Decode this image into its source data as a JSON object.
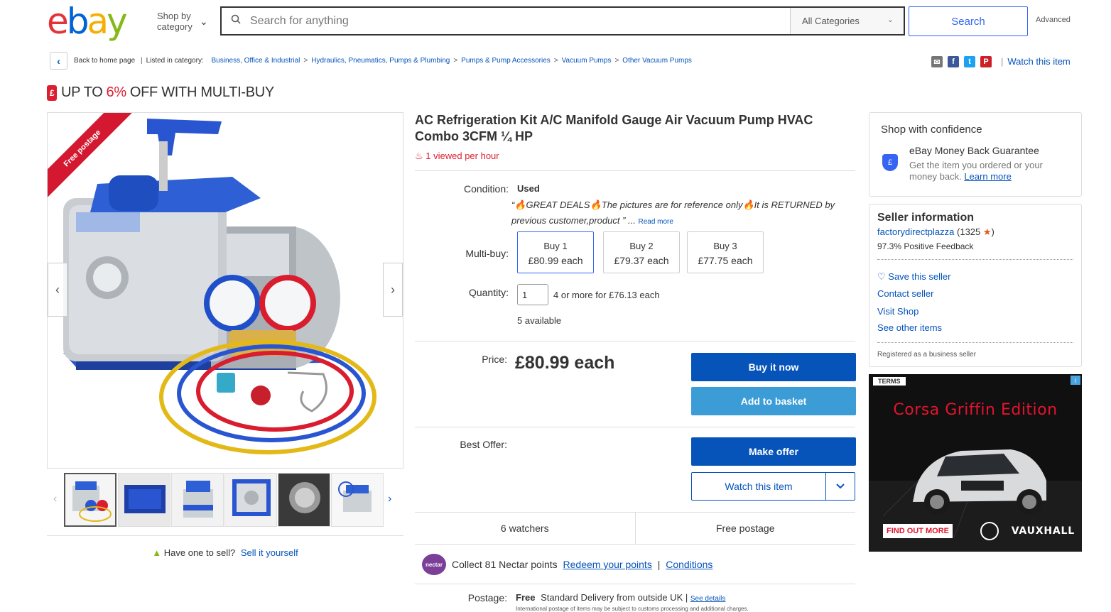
{
  "header": {
    "logo_letters": [
      "e",
      "b",
      "a",
      "y"
    ],
    "logo_colors": [
      "#e53238",
      "#0064d2",
      "#f5af02",
      "#86b817"
    ],
    "shop_by_line1": "Shop by",
    "shop_by_line2": "category",
    "search_placeholder": "Search for anything",
    "category_select": "All Categories",
    "search_button": "Search",
    "advanced_link": "Advanced"
  },
  "breadcrumb": {
    "back_label": "Back to home page",
    "listed_in": "Listed in category:",
    "items": [
      "Business, Office & Industrial",
      "Hydraulics, Pneumatics, Pumps & Plumbing",
      "Pumps & Pump Accessories",
      "Vacuum Pumps",
      "Other Vacuum Pumps"
    ],
    "watch_item": "Watch this item",
    "share_icons": [
      "email-icon",
      "facebook-icon",
      "twitter-icon",
      "pinterest-icon"
    ]
  },
  "promo": {
    "prefix": "UP TO",
    "percent": "6%",
    "suffix": "OFF WITH MULTI-BUY"
  },
  "gallery": {
    "ribbon": "Free postage",
    "thumbnail_count": 6
  },
  "sell": {
    "question": "Have one to sell?",
    "link": "Sell it yourself"
  },
  "item": {
    "title": "AC Refrigeration Kit A/C Manifold Gauge Air Vacuum Pump HVAC Combo 3CFM ¼ HP",
    "viewed": "1 viewed per hour",
    "condition_label": "Condition:",
    "condition_value": "Used",
    "condition_desc": "“🔥GREAT DEALS🔥The pictures are for reference only🔥It is RETURNED by previous customer,product ” ...",
    "read_more": "Read more",
    "multibuy_label": "Multi-buy:",
    "multibuy": [
      {
        "qty": "Buy 1",
        "price": "£80.99 each"
      },
      {
        "qty": "Buy 2",
        "price": "£79.37 each"
      },
      {
        "qty": "Buy 3",
        "price": "£77.75 each"
      }
    ],
    "quantity_label": "Quantity:",
    "quantity_value": "1",
    "quantity_deal": "4 or more for £76.13 each",
    "available": "5 available",
    "price_label": "Price:",
    "price": "£80.99 each",
    "buy_now": "Buy it now",
    "add_basket": "Add to basket",
    "best_offer_label": "Best Offer:",
    "make_offer": "Make offer",
    "watch_button": "Watch this item",
    "watchers": "6 watchers",
    "free_postage": "Free postage",
    "nectar_badge": "nectar",
    "nectar_text": "Collect 81 Nectar points",
    "nectar_redeem": "Redeem your points",
    "nectar_conditions": "Conditions",
    "postage_label": "Postage:",
    "postage_free": "Free",
    "postage_detail": "Standard Delivery from outside UK |",
    "see_details": "See details",
    "intl_note": "International postage of items may be subject to customs processing and additional charges."
  },
  "confidence": {
    "heading": "Shop with confidence",
    "guarantee": "eBay Money Back Guarantee",
    "guarantee_desc": "Get the item you ordered or your money back.",
    "learn_more": "Learn more"
  },
  "seller": {
    "heading": "Seller information",
    "name": "factorydirectplazza",
    "feedback_count": "(1325",
    "feedback_close": ")",
    "positive": "97.3% Positive Feedback",
    "links": [
      "Save this seller",
      "Contact seller",
      "Visit Shop",
      "See other items"
    ],
    "registered": "Registered as a business seller"
  },
  "ad": {
    "terms": "TERMS",
    "headline": "Corsa Griffin Edition",
    "cta": "FIND OUT MORE",
    "brand": "VAUXHALL"
  }
}
